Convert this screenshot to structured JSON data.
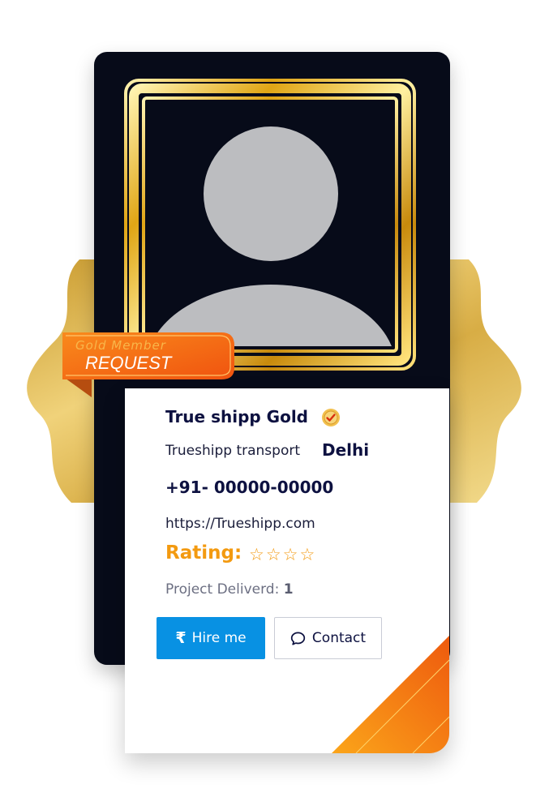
{
  "badge": {
    "line1": "Gold Member",
    "line2": "REQUEST"
  },
  "profile": {
    "name": "True shipp Gold",
    "company": "Trueshipp transport",
    "city": "Delhi",
    "phone": "+91- 00000-00000",
    "website": "https://Trueshipp.com",
    "rating_label": "Rating:",
    "rating_stars": 0,
    "rating_max": 4,
    "projects_label": "Project Deliverd:",
    "projects_count": "1"
  },
  "actions": {
    "hire_label": "Hire me",
    "contact_label": "Contact"
  },
  "icons": {
    "avatar": "default-user-avatar",
    "verified": "verified-check-icon",
    "star": "star-outline-icon",
    "rupee": "rupee-icon",
    "chat": "chat-bubble-icon"
  },
  "colors": {
    "card_dark": "#070b19",
    "accent_orange": "#f39a10",
    "button_blue": "#0891e3",
    "text_navy": "#0d1140",
    "gold": "#e0b743"
  }
}
